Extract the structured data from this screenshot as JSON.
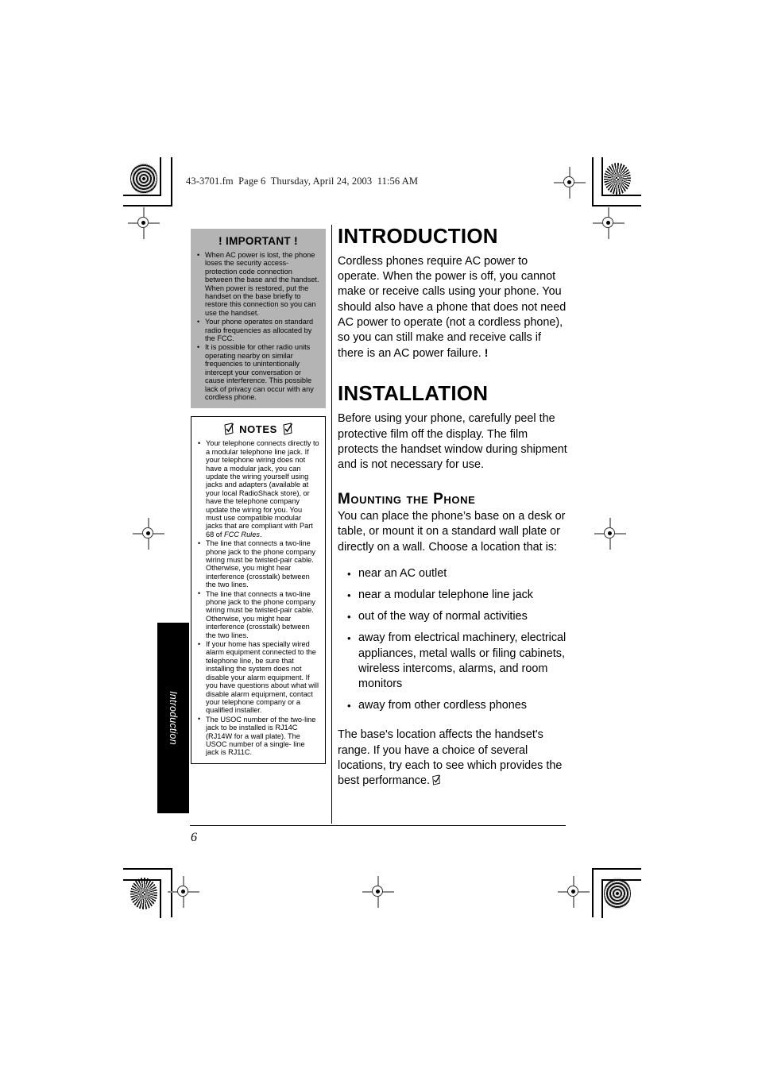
{
  "file_header": "43-3701.fm  Page 6  Thursday, April 24, 2003  11:56 AM",
  "folio": "6",
  "thumb_tab": {
    "label": "Introduction"
  },
  "sidebar": {
    "important": {
      "title_left_mark": "!",
      "title": "IMPORTANT",
      "title_right_mark": "!",
      "bullets": [
        "When AC power is lost, the phone loses the security access-protection code connection between the base and the handset. When power is restored, put the handset on the base briefly to restore this connection so you can use the handset.",
        "Your phone operates on standard radio frequencies as allocated by the FCC.",
        "It is possible for other radio units operating nearby on similar frequencies to unintentionally intercept your conversation or cause interference. This possible lack of privacy can occur with any cordless phone."
      ]
    },
    "notes": {
      "title": "NOTES",
      "bullets": [
        "Your telephone connects directly to a modular telephone line jack. If your telephone wiring does not have a modular jack, you can update the wiring yourself using jacks and adapters (available at your local RadioShack store), or have the telephone company update the wiring for you. You must use compatible modular jacks that are compliant with Part 68 of ",
        "The line that connects a two-line phone jack to the phone company wiring must be twisted-pair cable. Otherwise, you might hear interference (crosstalk) between the two lines.",
        "The line that connects a two-line phone jack to the phone company wiring must be twisted-pair cable. Otherwise, you might hear interference (crosstalk) between the two lines.",
        "If your home has specially wired alarm equipment connected to the telephone line, be sure that installing the system does not disable your alarm equipment. If you have questions about what will disable alarm equipment, contact your telephone company or a qualified installer.",
        "The USOC number of the two-line jack to be installed is RJ14C (RJ14W for a wall plate). The USOC number of a single- line jack is RJ11C."
      ],
      "bullet_1_italic_tail": "FCC Rules",
      "bullet_1_tail_period": "."
    }
  },
  "main": {
    "introduction": {
      "heading": "INTRODUCTION",
      "paragraph": "Cordless phones require AC power to operate. When the power is off, you cannot make or receive calls using your phone. You should also have a phone that does not need AC power to operate (not a cordless phone), so you can still make and receive calls if there is an AC power failure.",
      "trailing_mark": "!"
    },
    "installation": {
      "heading": "INSTALLATION",
      "paragraph": "Before using your phone, carefully peel the protective film off the display. The film protects the handset window during shipment and is not necessary for use."
    },
    "mounting": {
      "heading": "Mounting the Phone",
      "intro_paragraph": "You can place the phone’s base on a desk or table, or mount it on a standard wall plate or directly on a wall. Choose a location that is:",
      "bullets": [
        "near an AC outlet",
        "near a modular telephone line jack",
        "out of the way of normal activities",
        "away from electrical machinery, electrical appliances, metal walls or filing cabinets, wireless intercoms, alarms, and room monitors",
        "away from other cordless phones"
      ],
      "closing_paragraph": "The base's location affects the handset's range. If you have a choice of several locations, try each to see which provides the best performance."
    }
  },
  "colors": {
    "important_box_background": "#b4b4b4",
    "ink": "#000000",
    "page_background": "#ffffff",
    "registration_gray": "#8a8a8a"
  }
}
